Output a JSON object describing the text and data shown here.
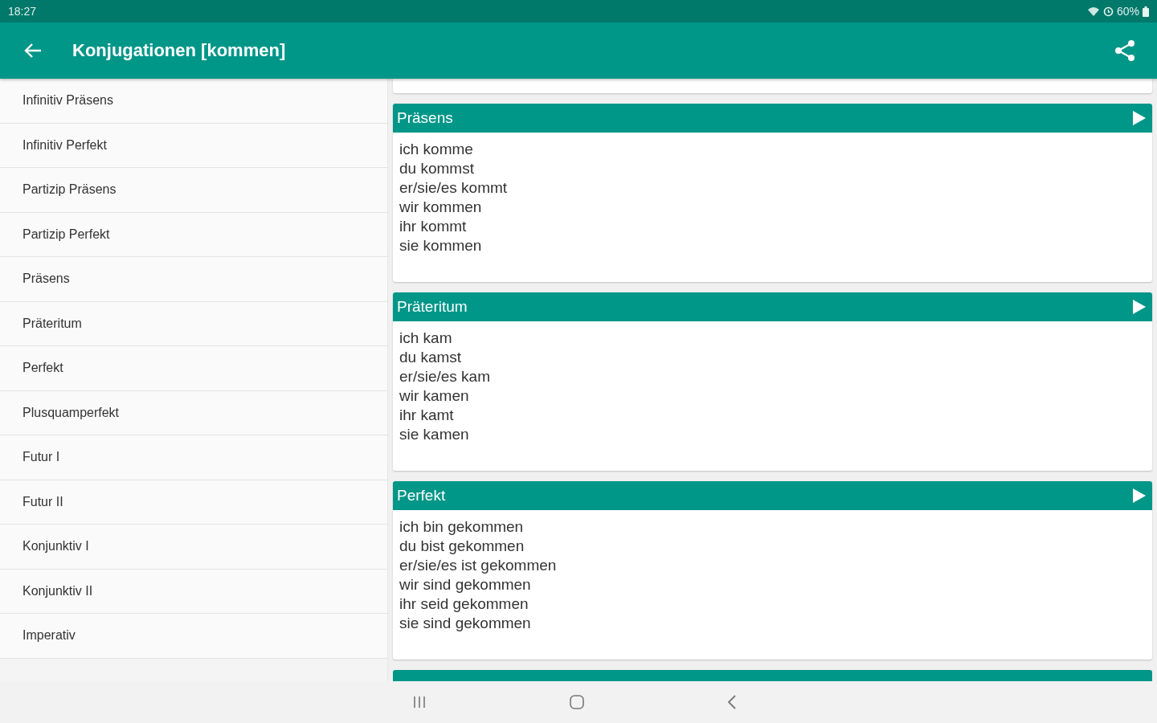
{
  "status_bar": {
    "time": "18:27",
    "battery": "60%"
  },
  "app_bar": {
    "title": "Konjugationen [kommen]"
  },
  "sidebar": {
    "items": [
      "Infinitiv Präsens",
      "Infinitiv Perfekt",
      "Partizip Präsens",
      "Partizip Perfekt",
      "Präsens",
      "Präteritum",
      "Perfekt",
      "Plusquamperfekt",
      "Futur I",
      "Futur II",
      "Konjunktiv I",
      "Konjunktiv II",
      "Imperativ"
    ]
  },
  "cards": [
    {
      "title": "Präsens",
      "lines": [
        "ich komme",
        "du kommst",
        "er/sie/es kommt",
        "wir kommen",
        "ihr kommt",
        "sie kommen"
      ]
    },
    {
      "title": "Präteritum",
      "lines": [
        "ich kam",
        "du kamst",
        "er/sie/es kam",
        "wir kamen",
        "ihr kamt",
        "sie kamen"
      ]
    },
    {
      "title": "Perfekt",
      "lines": [
        "ich bin gekommen",
        "du bist gekommen",
        "er/sie/es ist gekommen",
        "wir sind gekommen",
        "ihr seid gekommen",
        "sie sind gekommen"
      ]
    }
  ]
}
